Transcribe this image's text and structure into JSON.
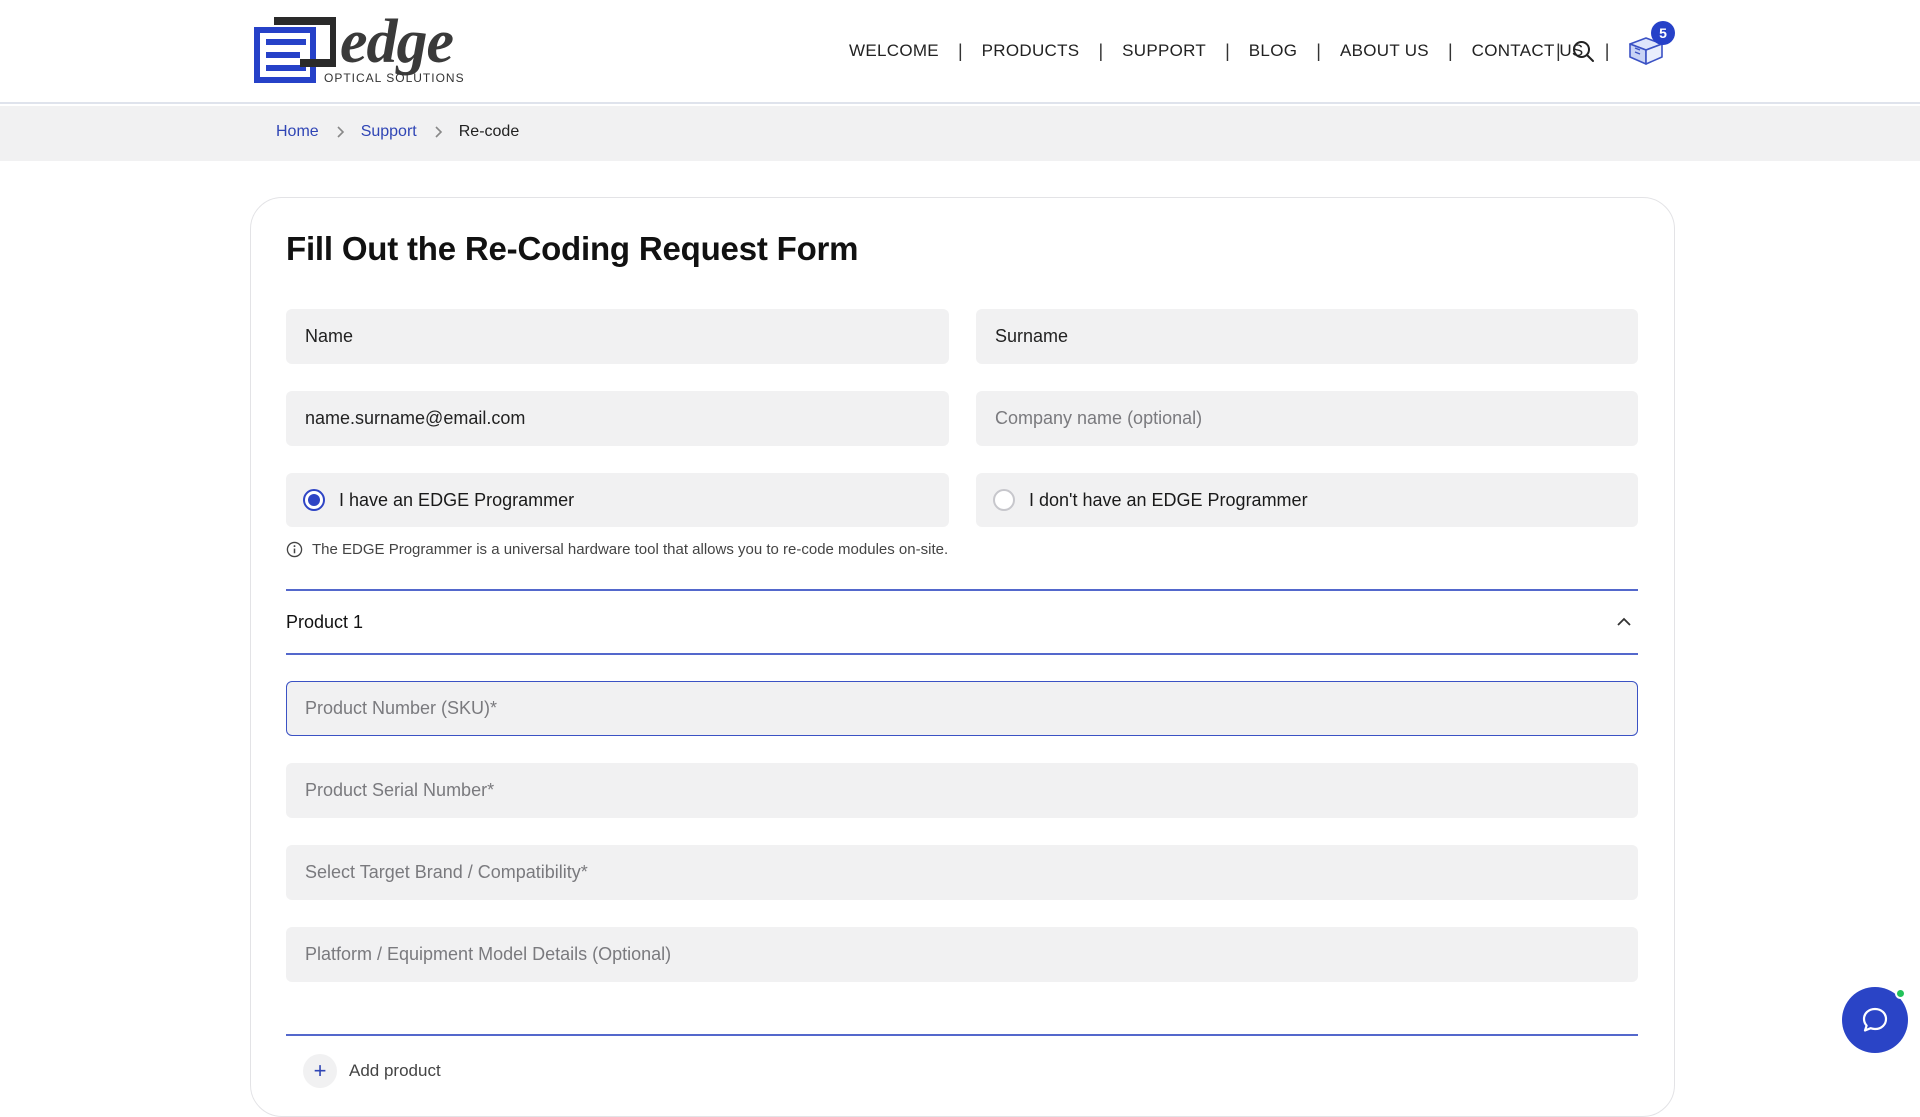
{
  "brand": {
    "name": "edge",
    "tagline": "OPTICAL SOLUTIONS",
    "color": "#2641c8"
  },
  "nav": {
    "items": [
      "WELCOME",
      "PRODUCTS",
      "SUPPORT",
      "BLOG",
      "ABOUT US",
      "CONTACT US"
    ],
    "tools": [
      "search-icon",
      "cart-icon"
    ]
  },
  "cart": {
    "count": "5"
  },
  "breadcrumb": {
    "items": [
      "Home",
      "Support"
    ],
    "current": "Re-code"
  },
  "form": {
    "title": "Fill Out the Re-Coding Request Form",
    "name_value": "Name",
    "surname_value": "Surname",
    "email_value": "name.surname@email.com",
    "company_placeholder": "Company name (optional)",
    "radio_have": "I have an EDGE Programmer",
    "radio_dont": "I don't have an EDGE Programmer",
    "radio_selected": "have",
    "info_text": "The EDGE Programmer is a universal hardware tool that allows you to re-code modules on-site.",
    "product": {
      "title": "Product 1",
      "sku_placeholder": "Product Number (SKU)*",
      "serial_placeholder": "Product Serial Number*",
      "brand_placeholder": "Select Target Brand / Compatibility*",
      "platform_placeholder": "Platform / Equipment Model Details (Optional)"
    },
    "add_product_label": "Add product"
  },
  "chat": {
    "icon": "chat-bubble-icon",
    "status_color": "#22c25a"
  }
}
